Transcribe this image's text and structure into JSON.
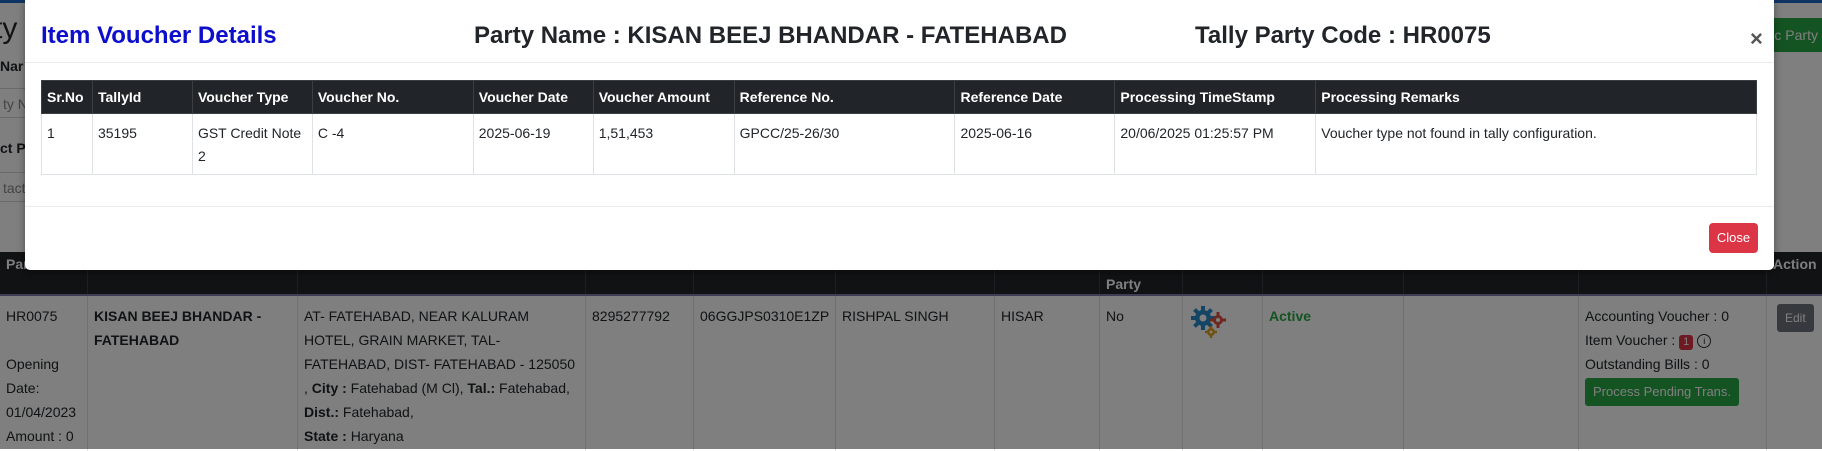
{
  "background": {
    "page_title": "ty",
    "top_button": "c Party",
    "labels": [
      "Nar",
      "ct P"
    ],
    "inputs": [
      "ty N",
      "tact"
    ],
    "table_headers": [
      {
        "l1": "Part",
        "l2": ""
      },
      {
        "l1": "",
        "l2": ""
      },
      {
        "l1": "",
        "l2": ""
      },
      {
        "l1": "",
        "l2": ""
      },
      {
        "l1": "",
        "l2": ""
      },
      {
        "l1": "",
        "l2": ""
      },
      {
        "l1": "",
        "l2": ""
      },
      {
        "l1": "",
        "l2": "Party"
      },
      {
        "l1": "",
        "l2": ""
      },
      {
        "l1": "",
        "l2": ""
      },
      {
        "l1": "",
        "l2": ""
      },
      {
        "l1": "",
        "l2": ""
      },
      {
        "l1": "Action",
        "l2": ""
      }
    ],
    "row": {
      "code": "HR0075",
      "opening_label": "Opening",
      "date_label": "Date:",
      "opening_date": "01/04/2023",
      "amount": "Amount : 0",
      "party_name": "KISAN BEEJ BHANDAR - FATEHABAD",
      "address_line": "AT- FATEHABAD, NEAR KALURAM HOTEL, GRAIN MARKET, TAL- FATEHABAD, DIST- FATEHABAD - 125050 ,",
      "city_label": "City :",
      "city": "Fatehabad (M Cl),",
      "tal_label": "Tal.:",
      "tal": "Fatehabad,",
      "dist_label": "Dist.:",
      "dist": "Fatehabad,",
      "state_label": "State :",
      "state": "Haryana",
      "mobile": "8295277792",
      "gstin": "06GGJPS0310E1ZP",
      "contact": "RISHPAL SINGH",
      "area": "HISAR",
      "party_flag": "No",
      "status": "Active",
      "accounting_voucher": "Accounting Voucher : 0",
      "item_voucher_label": "Item Voucher :",
      "item_voucher_count": "1",
      "outstanding_bills": "Outstanding Bills : 0",
      "process_button": "Process Pending Trans.",
      "edit_button": "Edit"
    }
  },
  "modal": {
    "title": "Item Voucher Details",
    "party_name": "Party Name : KISAN BEEJ BHANDAR - FATEHABAD",
    "tally_code": "Tally Party Code : HR0075",
    "close_x": "×",
    "close_button": "Close",
    "columns": [
      "Sr.No",
      "TallyId",
      "Voucher Type",
      "Voucher No.",
      "Voucher Date",
      "Voucher Amount",
      "Reference No.",
      "Reference Date",
      "Processing TimeStamp",
      "Processing Remarks"
    ],
    "rows": [
      [
        "1",
        "35195",
        "GST Credit Note 2",
        "C -4",
        "2025-06-19",
        "1,51,453",
        "GPCC/25-26/30",
        "2025-06-16",
        "20/06/2025 01:25:57 PM",
        "Voucher type not found in tally configuration."
      ]
    ]
  },
  "colors": {
    "title_blue": "#0d0dcc",
    "header_dark": "#212529",
    "danger": "#dc3545",
    "success": "#28a745"
  }
}
